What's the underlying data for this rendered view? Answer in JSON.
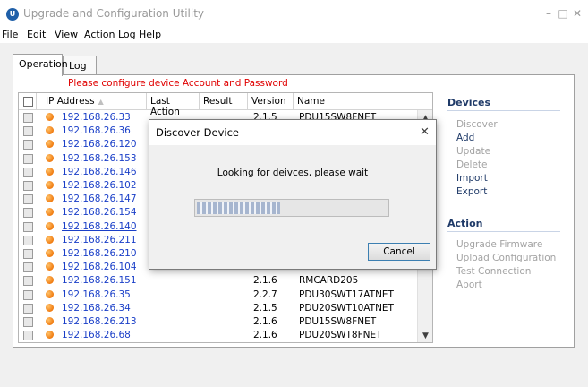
{
  "window": {
    "title": "Upgrade and Configuration Utility",
    "icon_name": "app-logo-icon"
  },
  "menu": [
    "File",
    "Edit",
    "View",
    "Action",
    "Log",
    "Help"
  ],
  "tabs": [
    "Operation",
    "Log"
  ],
  "warning": "Please configure device Account and Password",
  "table": {
    "columns": [
      "IP Address",
      "Last Action",
      "Result",
      "Version",
      "Name"
    ],
    "rows": [
      {
        "ip": "192.168.26.33",
        "version": "2.1.5",
        "name": "PDU15SW8FNET"
      },
      {
        "ip": "192.168.26.36",
        "version": "",
        "name": ""
      },
      {
        "ip": "192.168.26.120",
        "version": "",
        "name": ""
      },
      {
        "ip": "192.168.26.153",
        "version": "",
        "name": ""
      },
      {
        "ip": "192.168.26.146",
        "version": "",
        "name": ""
      },
      {
        "ip": "192.168.26.102",
        "version": "",
        "name": ""
      },
      {
        "ip": "192.168.26.147",
        "version": "",
        "name": ""
      },
      {
        "ip": "192.168.26.154",
        "version": "",
        "name": ""
      },
      {
        "ip": "192.168.26.140",
        "version": "",
        "name": ""
      },
      {
        "ip": "192.168.26.211",
        "version": "",
        "name": ""
      },
      {
        "ip": "192.168.26.210",
        "version": "",
        "name": ""
      },
      {
        "ip": "192.168.26.104",
        "version": "",
        "name": ""
      },
      {
        "ip": "192.168.26.151",
        "version": "2.1.6",
        "name": "RMCARD205"
      },
      {
        "ip": "192.168.26.35",
        "version": "2.2.7",
        "name": "PDU30SWT17ATNET"
      },
      {
        "ip": "192.168.26.34",
        "version": "2.1.5",
        "name": "PDU20SWT10ATNET"
      },
      {
        "ip": "192.168.26.213",
        "version": "2.1.6",
        "name": "PDU15SW8FNET"
      },
      {
        "ip": "192.168.26.68",
        "version": "2.1.6",
        "name": "PDU20SWT8FNET"
      }
    ]
  },
  "side": {
    "devices_title": "Devices",
    "devices_items": [
      {
        "label": "Discover",
        "enabled": false
      },
      {
        "label": "Add",
        "enabled": true
      },
      {
        "label": "Update",
        "enabled": false
      },
      {
        "label": "Delete",
        "enabled": false
      },
      {
        "label": "Import",
        "enabled": true
      },
      {
        "label": "Export",
        "enabled": true
      }
    ],
    "action_title": "Action",
    "action_items": [
      {
        "label": "Upgrade Firmware",
        "enabled": false
      },
      {
        "label": "Upload Configuration",
        "enabled": false
      },
      {
        "label": "Test Connection",
        "enabled": false
      },
      {
        "label": "Abort",
        "enabled": false
      }
    ]
  },
  "dialog": {
    "title": "Discover Device",
    "message": "Looking for deivces, please wait",
    "progress": 0.44,
    "cancel_label": "Cancel"
  },
  "colors": {
    "accent": "#1f3a68",
    "link": "#1a3fc8",
    "warning": "#e00000",
    "status_dot": "#f07b10"
  }
}
